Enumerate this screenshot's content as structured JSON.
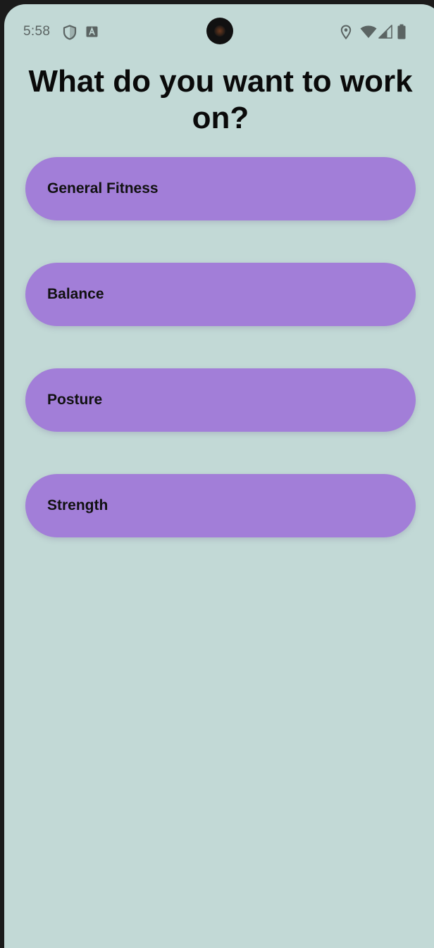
{
  "status_bar": {
    "time": "5:58",
    "left_icons": [
      "shield-icon",
      "a-text-icon"
    ],
    "right_icons": [
      "location-icon",
      "wifi-icon",
      "signal-icon",
      "battery-icon"
    ]
  },
  "page": {
    "title": "What do you want to work on?"
  },
  "options": [
    {
      "label": "General Fitness"
    },
    {
      "label": "Balance"
    },
    {
      "label": "Posture"
    },
    {
      "label": "Strength"
    }
  ],
  "colors": {
    "background": "#c2d9d6",
    "option_fill": "#a27ed8",
    "text": "#0a0a0a"
  }
}
